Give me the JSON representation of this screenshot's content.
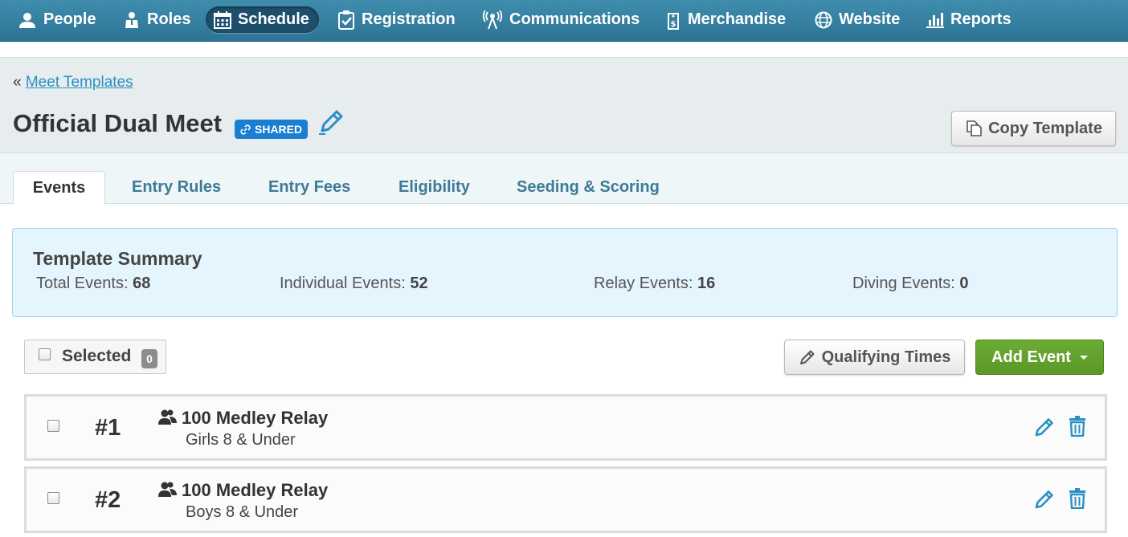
{
  "nav": {
    "items": [
      {
        "label": "People",
        "icon": "person-icon"
      },
      {
        "label": "Roles",
        "icon": "role-icon"
      },
      {
        "label": "Schedule",
        "icon": "calendar-icon",
        "active": true
      },
      {
        "label": "Registration",
        "icon": "clipboard-check-icon"
      },
      {
        "label": "Communications",
        "icon": "broadcast-icon"
      },
      {
        "label": "Merchandise",
        "icon": "price-tag-icon"
      },
      {
        "label": "Website",
        "icon": "globe-icon"
      },
      {
        "label": "Reports",
        "icon": "bar-chart-icon"
      }
    ]
  },
  "breadcrumb": {
    "prefix": "«",
    "link": "Meet Templates"
  },
  "page": {
    "title": "Official Dual Meet",
    "badge": "SHARED",
    "copy_button": "Copy Template"
  },
  "tabs": [
    {
      "label": "Events",
      "active": true
    },
    {
      "label": "Entry Rules"
    },
    {
      "label": "Entry Fees"
    },
    {
      "label": "Eligibility"
    },
    {
      "label": "Seeding & Scoring"
    }
  ],
  "summary": {
    "title": "Template Summary",
    "stats": [
      {
        "label": "Total Events:",
        "value": "68"
      },
      {
        "label": "Individual Events:",
        "value": "52"
      },
      {
        "label": "Relay Events:",
        "value": "16"
      },
      {
        "label": "Diving Events:",
        "value": "0"
      }
    ]
  },
  "toolbar": {
    "selected_label": "Selected",
    "selected_count": "0",
    "qualifying_button": "Qualifying Times",
    "add_button": "Add Event"
  },
  "events": [
    {
      "number": "#1",
      "name": "100 Medley Relay",
      "group": "Girls 8 & Under"
    },
    {
      "number": "#2",
      "name": "100 Medley Relay",
      "group": "Boys 8 & Under"
    }
  ],
  "colors": {
    "nav_bg": "#3586a7",
    "link": "#2b8fc4",
    "badge": "#1a7fd0",
    "add_button": "#5fa02a",
    "summary_bg": "#e5f5fd"
  }
}
